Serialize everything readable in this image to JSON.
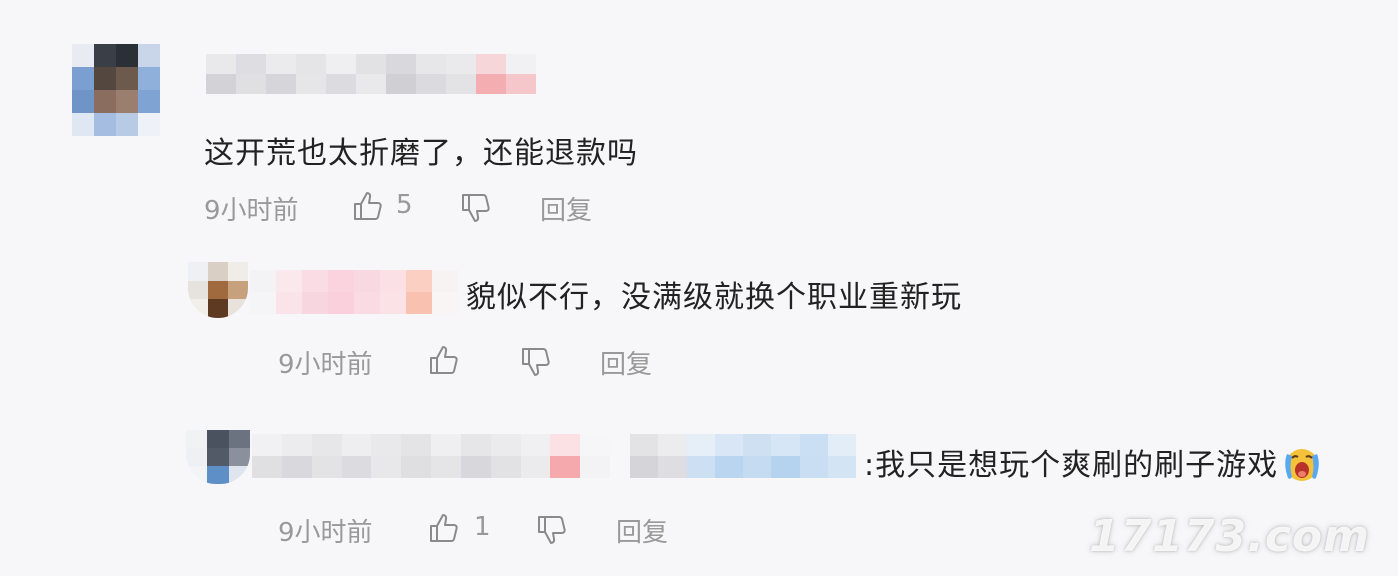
{
  "comments": [
    {
      "text": "这开荒也太折磨了，还能退款吗",
      "time": "9小时前",
      "likes": "5",
      "reply_label": "回复"
    },
    {
      "text": "貌似不行，没满级就换个职业重新玩",
      "time": "9小时前",
      "likes": "",
      "reply_label": "回复"
    },
    {
      "text": ":我只是想玩个爽刷的刷子游戏",
      "time": "9小时前",
      "likes": "1",
      "reply_label": "回复"
    }
  ],
  "icons": {
    "like": "thumbs-up-icon",
    "dislike": "thumbs-down-icon",
    "emoji": "crying-face-emoji"
  },
  "watermark": "17173.com"
}
